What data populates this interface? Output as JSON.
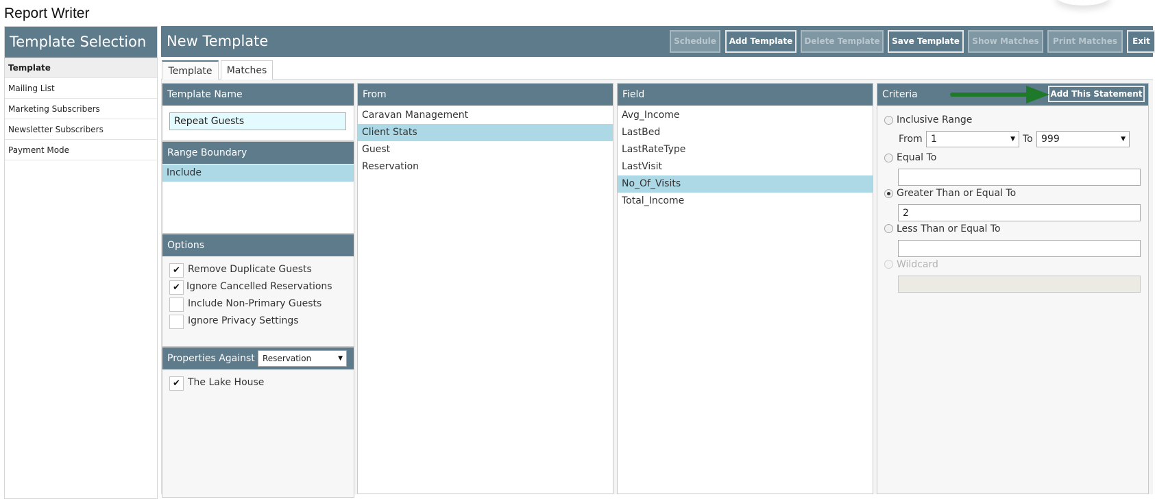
{
  "app_title": "Report Writer",
  "sidebar": {
    "title": "Template Selection",
    "items": [
      {
        "label": "Template"
      },
      {
        "label": "Mailing List"
      },
      {
        "label": "Marketing Subscribers"
      },
      {
        "label": "Newsletter Subscribers"
      },
      {
        "label": "Payment Mode"
      }
    ]
  },
  "header": {
    "title": "New Template",
    "buttons": {
      "schedule": "Schedule",
      "add_template": "Add Template",
      "delete_template": "Delete Template",
      "save_template": "Save Template",
      "show_matches": "Show Matches",
      "print_matches": "Print Matches",
      "exit": "Exit"
    }
  },
  "tabs": {
    "template": "Template",
    "matches": "Matches"
  },
  "template_name": {
    "heading": "Template Name",
    "value": "Repeat Guests"
  },
  "range_boundary": {
    "heading": "Range Boundary",
    "items": [
      {
        "label": "Include"
      }
    ]
  },
  "options": {
    "heading": "Options",
    "items": [
      {
        "label": "Remove Duplicate Guests",
        "mark": "✔"
      },
      {
        "label": "Ignore Cancelled Reservations",
        "mark": "✔"
      },
      {
        "label": "Include Non-Primary Guests",
        "mark": ""
      },
      {
        "label": "Ignore Privacy Settings",
        "mark": ""
      }
    ]
  },
  "properties": {
    "heading": "Properties Against",
    "select_value": "Reservation",
    "items": [
      {
        "label": "The Lake House",
        "mark": "✔"
      }
    ]
  },
  "from": {
    "heading": "From",
    "items": [
      {
        "label": "Caravan Management"
      },
      {
        "label": "Client Stats"
      },
      {
        "label": "Guest"
      },
      {
        "label": "Reservation"
      }
    ]
  },
  "field": {
    "heading": "Field",
    "items": [
      {
        "label": "Avg_Income"
      },
      {
        "label": "LastBed"
      },
      {
        "label": "LastRateType"
      },
      {
        "label": "LastVisit"
      },
      {
        "label": "No_Of_Visits"
      },
      {
        "label": "Total_Income"
      }
    ]
  },
  "criteria": {
    "heading": "Criteria",
    "add_statement": "Add This Statement",
    "inclusive_range": "Inclusive Range",
    "from_label": "From",
    "from_value": "1",
    "to_label": "To",
    "to_value": "999",
    "equal_to": "Equal To",
    "equal_to_value": "",
    "greater_equal": "Greater Than or Equal To",
    "greater_equal_value": "2",
    "less_equal": "Less Than or Equal To",
    "less_equal_value": "",
    "wildcard": "Wildcard",
    "wildcard_value": ""
  },
  "colors": {
    "header": "#5e7b8b",
    "selection": "#add8e6",
    "arrow": "#1e7a2a"
  }
}
